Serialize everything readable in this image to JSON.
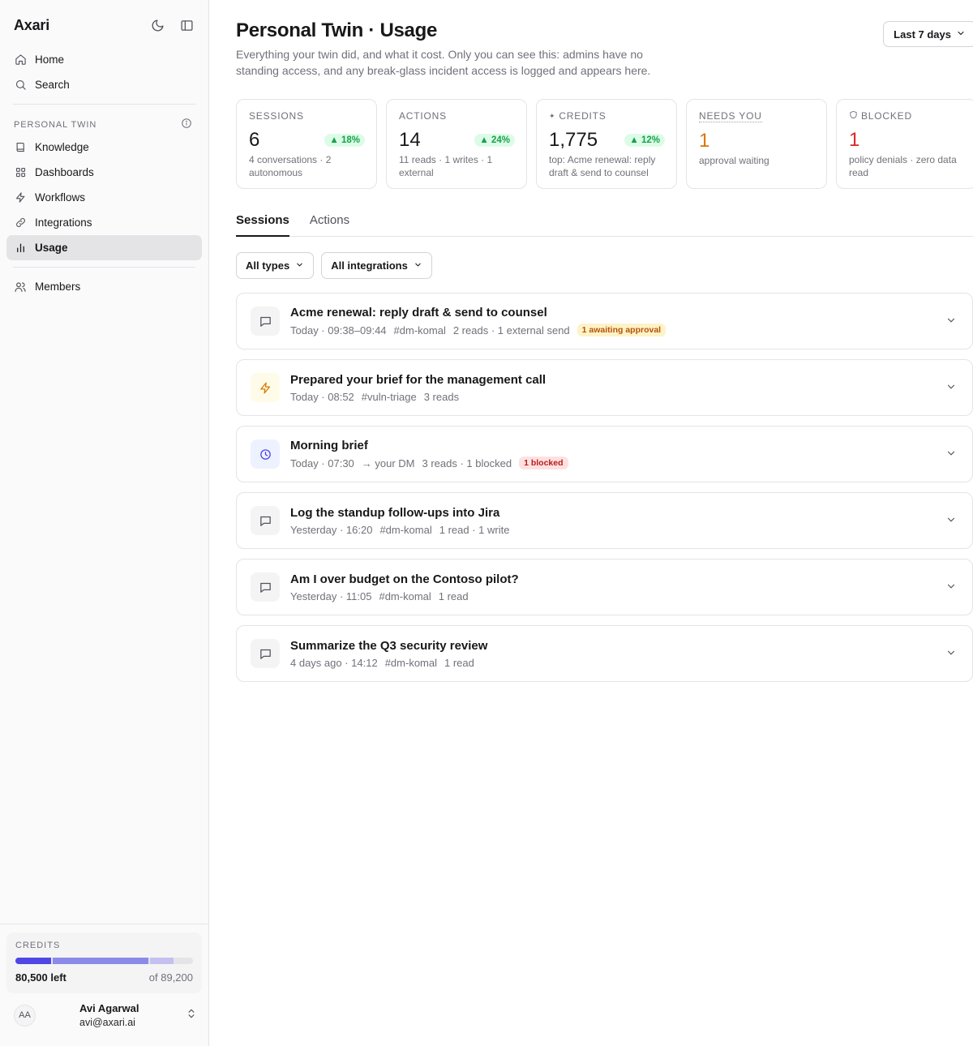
{
  "app": {
    "brand": "Axari"
  },
  "sidebar": {
    "nav_top": [
      {
        "label": "Home",
        "icon": "home-icon"
      },
      {
        "label": "Search",
        "icon": "search-icon"
      }
    ],
    "section_title": "PERSONAL TWIN",
    "nav_twin": [
      {
        "label": "Knowledge",
        "icon": "book-icon"
      },
      {
        "label": "Dashboards",
        "icon": "grid-icon"
      },
      {
        "label": "Workflows",
        "icon": "bolt-icon"
      },
      {
        "label": "Integrations",
        "icon": "link-icon"
      },
      {
        "label": "Usage",
        "icon": "bar-chart-icon",
        "active": true
      }
    ],
    "nav_bottom": [
      {
        "label": "Members",
        "icon": "users-icon"
      }
    ],
    "credits": {
      "title": "CREDITS",
      "left_label": "80,500 left",
      "total_label": "of 89,200",
      "segments_pct": [
        20,
        54,
        13
      ],
      "colors": [
        "#4f46e5",
        "#8b8ae8",
        "#c4c0f0"
      ]
    },
    "user": {
      "initials": "AA",
      "name": "Avi Agarwal",
      "email": "avi@axari.ai"
    }
  },
  "header": {
    "title": "Personal Twin · Usage",
    "description": "Everything your twin did, and what it cost. Only you can see this: admins have no standing access, and any break-glass incident access is logged and appears here.",
    "range": "Last 7 days"
  },
  "stats": [
    {
      "label": "SESSIONS",
      "value": "6",
      "delta": "▲ 18%",
      "sub": "4 conversations · 2 autonomous"
    },
    {
      "label": "ACTIONS",
      "value": "14",
      "delta": "▲ 24%",
      "sub": "11 reads · 1 writes · 1 external"
    },
    {
      "label": "CREDITS",
      "value": "1,775",
      "delta": "▲ 12%",
      "sub": "top: Acme renewal: reply draft & send to counsel"
    },
    {
      "label": "NEEDS YOU",
      "value": "1",
      "delta": "",
      "sub": "approval waiting"
    },
    {
      "label": "BLOCKED",
      "value": "1",
      "delta": "",
      "sub": "policy denials · zero data read"
    }
  ],
  "tabs": [
    "Sessions",
    "Actions"
  ],
  "filters": [
    "All types",
    "All integrations"
  ],
  "sessions": [
    {
      "title": "Acme renewal: reply draft & send to counsel",
      "time": "Today · 09:38–09:44",
      "channel": "#dm-komal",
      "stats": "2 reads · 1 external send",
      "badge": "1 awaiting approval"
    },
    {
      "title": "Prepared your brief for the management call",
      "time": "Today · 08:52",
      "channel": "#vuln-triage",
      "stats": "3 reads",
      "badge": ""
    },
    {
      "title": "Morning brief",
      "time": "Today · 07:30",
      "channel": "→ your DM",
      "stats": "3 reads · 1 blocked",
      "badge": "1 blocked"
    },
    {
      "title": "Log the standup follow-ups into Jira",
      "time": "Yesterday · 16:20",
      "channel": "#dm-komal",
      "stats": "1 read · 1 write",
      "badge": ""
    },
    {
      "title": "Am I over budget on the Contoso pilot?",
      "time": "Yesterday · 11:05",
      "channel": "#dm-komal",
      "stats": "1 read",
      "badge": ""
    },
    {
      "title": "Summarize the Q3 security review",
      "time": "4 days ago · 14:12",
      "channel": "#dm-komal",
      "stats": "1 read",
      "badge": ""
    }
  ]
}
